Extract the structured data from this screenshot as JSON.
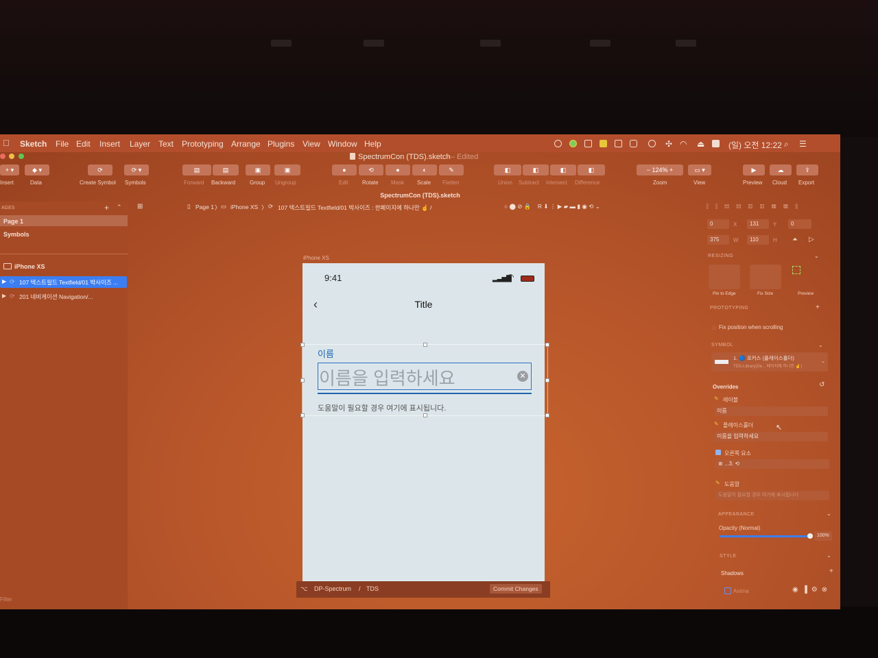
{
  "menubar": {
    "app_name": "Sketch",
    "items": [
      "File",
      "Edit",
      "Insert",
      "Layer",
      "Text",
      "Prototyping",
      "Arrange",
      "Plugins",
      "View",
      "Window",
      "Help"
    ],
    "clock": "(일) 오전 12:22"
  },
  "window": {
    "title": "SpectrumCon (TDS).sketch",
    "title_status": "— Edited",
    "document_name": "SpectrumCon (TDS).sketch"
  },
  "toolbar": {
    "insert_label": "Insert",
    "data_label": "Data",
    "create_symbol_label": "Create Symbol",
    "symbols_label": "Symbols",
    "forward_label": "Forward",
    "backward_label": "Backward",
    "group_label": "Group",
    "ungroup_label": "Ungroup",
    "edit_label": "Edit",
    "rotate_label": "Rotate",
    "mask_label": "Mask",
    "scale_label": "Scale",
    "flatten_label": "Flatten",
    "union_label": "Union",
    "subtract_label": "Subtract",
    "intersect_label": "Intersect",
    "difference_label": "Difference",
    "zoom_value": "124%",
    "zoom_label": "Zoom",
    "view_label": "View",
    "preview_label": "Preview",
    "cloud_label": "Cloud",
    "export_label": "Export"
  },
  "left_panel": {
    "pages_header": "AGES",
    "pages": [
      "Page 1",
      "Symbols"
    ],
    "artboard": "iPhone XS",
    "layers": [
      "107 텍스트필드 Textfield/01 박사이즈 ...",
      "201 네비게이션 Navigation/..."
    ],
    "filter_label": "Filter"
  },
  "breadcrumb": {
    "page": "Page 1",
    "artboard": "iPhone XS",
    "symbol": "107 텍스트필드 Textfield/01 박사이즈 : 한페이지에 하나만 ☝ /"
  },
  "canvas": {
    "artboard_label": "iPhone XS",
    "time": "9:41",
    "nav_title": "Title",
    "field_label": "이름",
    "placeholder": "이름을 입력하세요",
    "helper_text": "도움말이 필요할 경우 여기에 표시됩니다."
  },
  "inspector": {
    "x": "0",
    "y": "131",
    "rotation": "0",
    "w": "375",
    "h": "110",
    "x_label": "X",
    "y_label": "Y",
    "w_label": "W",
    "h_label": "H",
    "resizing_header": "RESIZING",
    "pin_to_edge": "Pin to Edge",
    "fix_size": "Fix Size",
    "preview": "Preview",
    "prototyping_header": "PROTOTYPING",
    "fix_position": "Fix position when scrolling",
    "symbol_header": "SYMBOL",
    "symbol_name": "1. 🔵 포커스 (플레이스홀더)",
    "symbol_library": "TDS-Library(De... 페이지에 하나만 ☝)",
    "overrides_header": "Overrides",
    "override_label_1": "레이블",
    "override_value_1": "이름",
    "override_label_2": "플레이스홀더",
    "override_value_2": "이름을 입력하세요",
    "override_label_3": "오른쪽 요소",
    "override_value_3": "...3.",
    "override_label_4": "도움말",
    "override_value_4": "도움말이 필요할 경우 여기에 표시됩니다",
    "appearance_header": "APPEARANCE",
    "opacity_label": "Opacity (Normal)",
    "opacity_value": "100%",
    "opacity_level": 1.0,
    "style_header": "STYLE",
    "shadows_label": "Shadows",
    "anima_label": "Anima"
  },
  "bottombar": {
    "repo": "DP-Spectrum",
    "separator": "/",
    "branch": "TDS",
    "commit_button": "Commit Changes"
  },
  "colors": {
    "screen": "#b6552a",
    "artboard": "#dce6ea",
    "selection": "#2f7cf6",
    "accent_field": "#1e64b0"
  }
}
